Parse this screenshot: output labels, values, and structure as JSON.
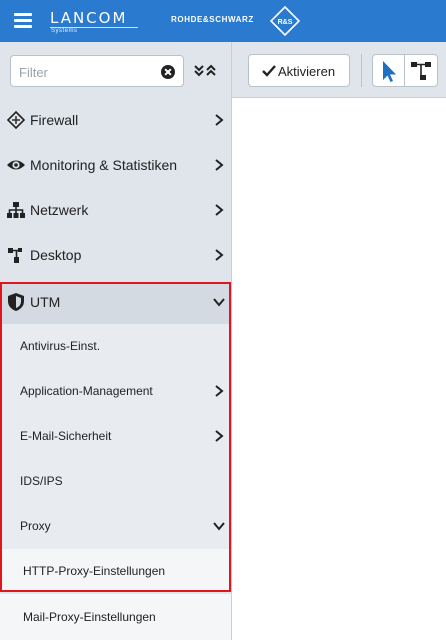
{
  "header": {
    "brand": "LANCOM",
    "brand_sub": "Systems",
    "partner": "ROHDE&SCHWARZ",
    "partner_logo_text": "R&S"
  },
  "sidebar": {
    "filter_placeholder": "Filter",
    "items": [
      {
        "label": "Firewall",
        "icon": "firewall-icon"
      },
      {
        "label": "Monitoring & Statistiken",
        "icon": "eye-icon"
      },
      {
        "label": "Netzwerk",
        "icon": "network-icon"
      },
      {
        "label": "Desktop",
        "icon": "desktop-icon"
      }
    ],
    "utm": {
      "label": "UTM",
      "icon": "shield-icon",
      "children": [
        {
          "label": "Antivirus-Einst."
        },
        {
          "label": "Application-Management"
        },
        {
          "label": "E-Mail-Sicherheit"
        },
        {
          "label": "IDS/IPS"
        },
        {
          "label": "Proxy"
        }
      ],
      "proxy_children": [
        {
          "label": "HTTP-Proxy-Einstellungen"
        },
        {
          "label": "Mail-Proxy-Einstellungen"
        }
      ]
    }
  },
  "toolbar": {
    "activate_label": "Aktivieren"
  },
  "colors": {
    "header_blue": "#2a7bd0",
    "sidebar_bg": "#dfe5ea",
    "highlight_red": "#e2141e"
  }
}
